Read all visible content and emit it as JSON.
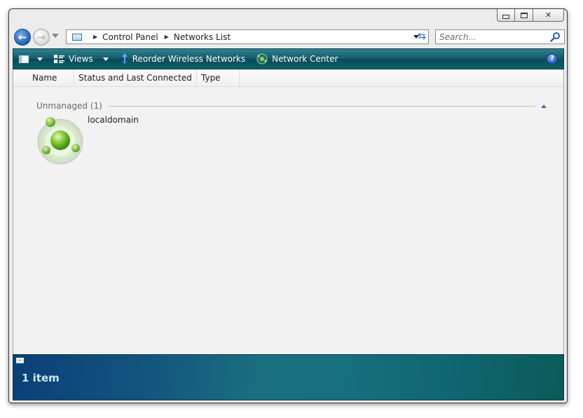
{
  "address_bar": {
    "breadcrumbs": [
      "Control Panel",
      "Networks List"
    ]
  },
  "search": {
    "placeholder": "Search..."
  },
  "toolbar": {
    "views_label": "Views",
    "reorder_label": "Reorder Wireless Networks",
    "network_center_label": "Network Center",
    "help_label": "?"
  },
  "columns": [
    "Name",
    "Status and Last Connected",
    "Type"
  ],
  "group": {
    "label": "Unmanaged (1)"
  },
  "items": [
    {
      "name": "localdomain",
      "icon": "network-globe-icon"
    }
  ],
  "status": {
    "count": "1 item"
  },
  "colors": {
    "toolbar": "#14596a",
    "statusbar_left": "#0b3f78",
    "statusbar_right": "#0a5c5a",
    "accent_blue": "#1f5fb4",
    "network_green": "#6fb43a"
  }
}
